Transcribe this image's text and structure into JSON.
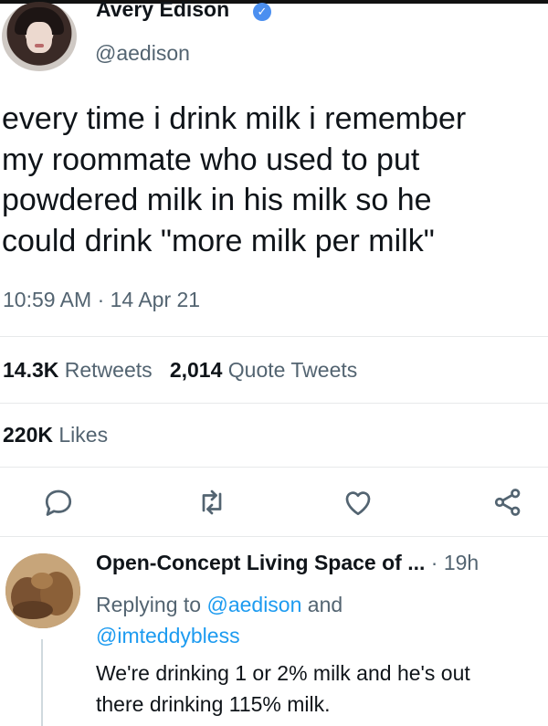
{
  "tweet": {
    "author_name": "Avery Edison",
    "handle": "@aedison",
    "verified": true,
    "lines": [
      "every time i drink milk i remember",
      "my roommate who used to put",
      "powdered milk in his milk so he",
      "could drink \"more milk per milk\""
    ],
    "timestamp": "10:59 AM · 14 Apr 21",
    "retweets_count": "14.3K",
    "retweets_label": "Retweets",
    "quote_count": "2,014",
    "quote_label": "Quote Tweets",
    "likes_count": "220K",
    "likes_label": "Likes"
  },
  "actions": {
    "icons": [
      "reply-icon",
      "retweet-icon",
      "like-icon",
      "share-icon"
    ]
  },
  "reply": {
    "author_name": "Open-Concept Living Space of ...",
    "separator": "·",
    "time": "19h",
    "replying_prefix": "Replying to",
    "mention_1": "@aedison",
    "and": "and",
    "mention_2": "@imteddybless",
    "line_1": "We're drinking 1 or 2% milk and he's out",
    "line_2": "there drinking 115% milk."
  },
  "colors": {
    "text": "#0f1419",
    "muted": "#536471",
    "accent": "#1d9bf0",
    "verified": "#4b8ff0"
  }
}
